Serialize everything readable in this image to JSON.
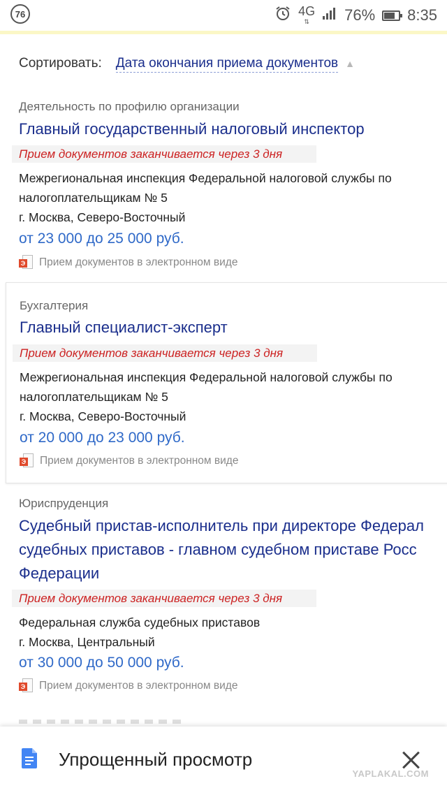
{
  "status_bar": {
    "badge": "76",
    "network": "4G",
    "battery": "76%",
    "battery_level": 0.76,
    "time": "8:35"
  },
  "sort": {
    "label": "Сортировать:",
    "value": "Дата окончания приема документов"
  },
  "jobs": [
    {
      "category": "Деятельность по профилю организации",
      "title_lines": [
        "Главный государственный налоговый инспектор"
      ],
      "deadline": "Прием документов заканчивается через 3 дня",
      "org_lines": [
        "Межрегиональная инспекция Федеральной налоговой службы по",
        "налогоплательщикам № 5"
      ],
      "location": "г. Москва, Северо-Восточный",
      "salary": "от 23 000 до 25 000 руб.",
      "electronic": "Прием документов в электронном виде"
    },
    {
      "category": "Бухгалтерия",
      "title_lines": [
        "Главный специалист-эксперт"
      ],
      "deadline": "Прием документов заканчивается через 3 дня",
      "org_lines": [
        "Межрегиональная инспекция Федеральной налоговой службы по",
        "налогоплательщикам № 5"
      ],
      "location": "г. Москва, Северо-Восточный",
      "salary": "от 20 000 до 23 000 руб.",
      "electronic": "Прием документов в электронном виде"
    },
    {
      "category": "Юриспруденция",
      "title_lines": [
        "Судебный пристав-исполнитель при директоре Федерал",
        "судебных приставов - главном судебном приставе Росс",
        "Федерации"
      ],
      "deadline": "Прием документов заканчивается через 3 дня",
      "org_lines": [
        "Федеральная служба судебных приставов"
      ],
      "location": "г. Москва, Центральный",
      "salary": "от 30 000 до 50 000 руб.",
      "electronic": "Прием документов в электронном виде"
    }
  ],
  "bottom_bar": {
    "title": "Упрощенный просмотр"
  },
  "watermark": "YAPLAKAL.COM"
}
